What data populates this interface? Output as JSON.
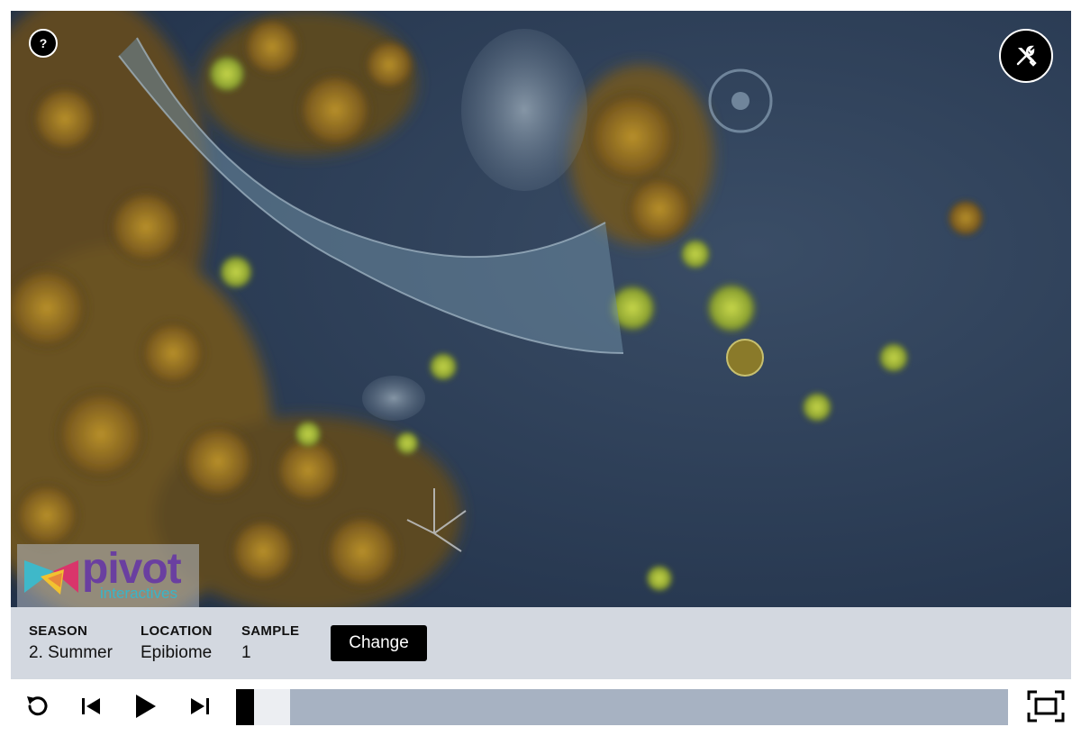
{
  "video": {
    "help_label": "?",
    "logo": {
      "text": "pivot",
      "subtext": "interactives"
    }
  },
  "info": {
    "season": {
      "label": "SEASON",
      "value": "2. Summer"
    },
    "location": {
      "label": "LOCATION",
      "value": "Epibiome"
    },
    "sample": {
      "label": "SAMPLE",
      "value": "1"
    },
    "change_label": "Change"
  },
  "timeline": {
    "position_fraction": 0.0,
    "buffered_fraction": 0.07
  },
  "icons": {
    "help": "help-icon",
    "tools": "tools-icon",
    "replay": "replay-icon",
    "previous": "skip-previous-icon",
    "play": "play-icon",
    "next": "skip-next-icon",
    "fullscreen": "fullscreen-icon"
  },
  "colors": {
    "info_bar": "#d3d8e0",
    "timeline_track": "#a7b2c2",
    "timeline_buffer": "#eceef2",
    "button": "#000000"
  }
}
